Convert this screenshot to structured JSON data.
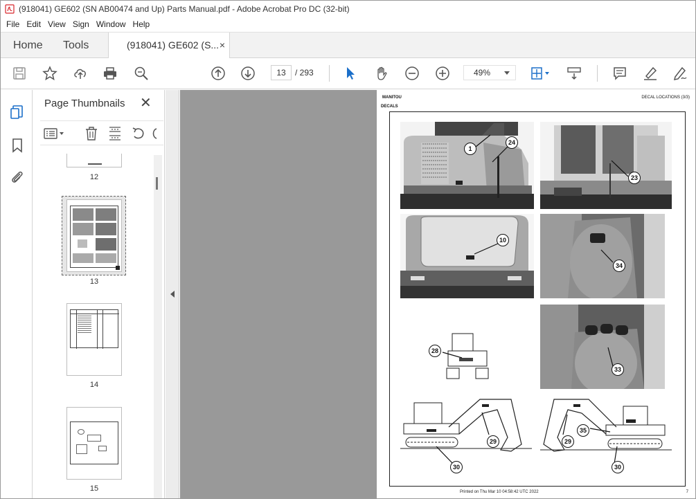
{
  "window": {
    "title": "(918041) GE602 (SN AB00474 and Up) Parts Manual.pdf - Adobe Acrobat Pro DC (32-bit)"
  },
  "menu": [
    "File",
    "Edit",
    "View",
    "Sign",
    "Window",
    "Help"
  ],
  "tabs": {
    "home": "Home",
    "tools": "Tools",
    "document": "(918041) GE602 (S...",
    "close": "×"
  },
  "toolbar": {
    "current_page": "13",
    "total_pages": "/ 293",
    "zoom": "49%",
    "icons": [
      "save-icon",
      "bookmark-star-icon",
      "upload-icon",
      "print-icon",
      "search-zoom-icon",
      "prev-page-icon",
      "next-page-icon",
      "select-pointer-icon",
      "hand-icon",
      "zoom-out-icon",
      "zoom-in-icon",
      "fit-page-icon",
      "scroll-mode-icon",
      "comment-icon",
      "highlight-icon",
      "sign-icon"
    ]
  },
  "thumbnails_panel": {
    "title": "Page Thumbnails",
    "close": "✕",
    "pages": [
      "12",
      "13",
      "14",
      "15"
    ],
    "current": "13"
  },
  "document_page": {
    "brand": "MANITOU",
    "section": "DECAL LOCATIONS (3/3)",
    "subheading": "DECALS",
    "footer": "Printed on  Thu Mar 10 04:58:42 UTC 2022",
    "page_number": "7",
    "callouts": [
      "1",
      "24",
      "23",
      "10",
      "34",
      "28",
      "33",
      "29",
      "30",
      "29",
      "35",
      "30"
    ]
  },
  "colors": {
    "accent": "#1b6fc9",
    "pdf_red": "#d7262b",
    "doc_bg": "#999999"
  }
}
